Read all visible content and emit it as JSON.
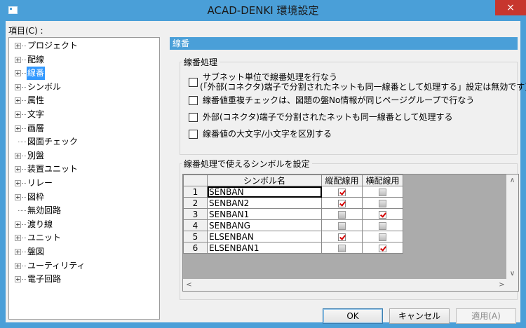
{
  "window": {
    "title": "ACAD-DENKI 環境設定",
    "close_glyph": "×"
  },
  "tree": {
    "label": "項目(C) :",
    "items": [
      {
        "label": "プロジェクト",
        "expandable": true,
        "selected": false
      },
      {
        "label": "配線",
        "expandable": true,
        "selected": false
      },
      {
        "label": "線番",
        "expandable": true,
        "selected": true
      },
      {
        "label": "シンボル",
        "expandable": true,
        "selected": false
      },
      {
        "label": "属性",
        "expandable": true,
        "selected": false
      },
      {
        "label": "文字",
        "expandable": true,
        "selected": false
      },
      {
        "label": "画層",
        "expandable": true,
        "selected": false
      },
      {
        "label": "図面チェック",
        "expandable": false,
        "selected": false
      },
      {
        "label": "別盤",
        "expandable": true,
        "selected": false
      },
      {
        "label": "装置ユニット",
        "expandable": true,
        "selected": false
      },
      {
        "label": "リレー",
        "expandable": true,
        "selected": false
      },
      {
        "label": "図枠",
        "expandable": true,
        "selected": false
      },
      {
        "label": "無効回路",
        "expandable": false,
        "selected": false
      },
      {
        "label": "渡り線",
        "expandable": true,
        "selected": false
      },
      {
        "label": "ユニット",
        "expandable": true,
        "selected": false
      },
      {
        "label": "盤図",
        "expandable": true,
        "selected": false
      },
      {
        "label": "ユーティリティ",
        "expandable": true,
        "selected": false
      },
      {
        "label": "電子回路",
        "expandable": true,
        "selected": false
      }
    ]
  },
  "panel": {
    "header": "線番",
    "processing_group": {
      "title": "線番処理",
      "options": [
        {
          "lines": [
            "サブネット単位で線番処理を行なう",
            "(「外部(コネクタ)端子で分割されたネットも同一線番として処理する」設定は無効です)"
          ],
          "checked": false
        },
        {
          "lines": [
            "線番値重複チェックは、図題の盤No情報が同じページグループで行なう"
          ],
          "checked": false
        },
        {
          "lines": [
            "外部(コネクタ)端子で分割されたネットも同一線番として処理する"
          ],
          "checked": false
        },
        {
          "lines": [
            "線番値の大文字/小文字を区別する"
          ],
          "checked": false
        }
      ]
    },
    "symbol_group": {
      "title": "線番処理で使えるシンボルを設定",
      "columns": [
        "シンボル名",
        "縦配線用",
        "横配線用"
      ],
      "rows": [
        {
          "num": "1",
          "name": "SENBAN",
          "vertical": true,
          "horizontal": false
        },
        {
          "num": "2",
          "name": "SENBAN2",
          "vertical": true,
          "horizontal": false
        },
        {
          "num": "3",
          "name": "SENBAN1",
          "vertical": false,
          "horizontal": true
        },
        {
          "num": "4",
          "name": "SENBANG",
          "vertical": false,
          "horizontal": false
        },
        {
          "num": "5",
          "name": "ELSENBAN",
          "vertical": true,
          "horizontal": false
        },
        {
          "num": "6",
          "name": "ELSENBAN1",
          "vertical": false,
          "horizontal": true
        }
      ]
    }
  },
  "buttons": {
    "ok": "OK",
    "cancel": "キャンセル",
    "apply": "適用(A)"
  },
  "icons": {
    "scroll_up": "∧",
    "scroll_down": "∨",
    "scroll_left": "<",
    "scroll_right": ">"
  }
}
